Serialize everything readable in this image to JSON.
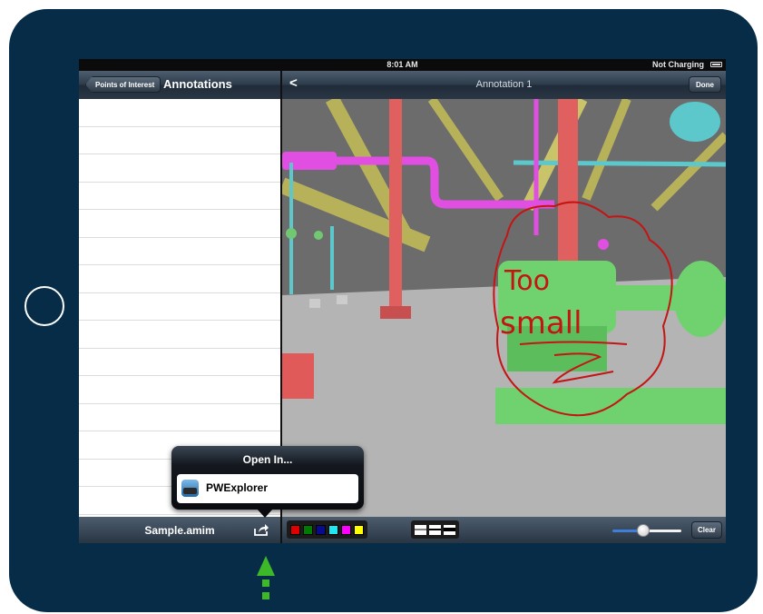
{
  "status_bar": {
    "time": "8:01 AM",
    "battery_label": "Not Charging"
  },
  "left_panel": {
    "back_button": "Points of Interest",
    "title": "Annotations",
    "file_name": "Sample.amim"
  },
  "right_panel": {
    "back_chevron": "<",
    "title": "Annotation 1",
    "done_button": "Done",
    "drawn_text_line1": "Too",
    "drawn_text_line2": "small"
  },
  "toolbar": {
    "colors": [
      "#e00000",
      "#007a00",
      "#0a0a8c",
      "#22e6f0",
      "#ff00ff",
      "#ffff00"
    ],
    "line_widths": [
      "thin",
      "medium",
      "thick"
    ],
    "brush_size": 0.45,
    "clear_button": "Clear"
  },
  "popover": {
    "title": "Open In...",
    "apps": [
      "PWExplorer"
    ]
  },
  "colors": {
    "device_frame": "#062c47",
    "annotation_ink": "#c41414",
    "arrow": "#3cb828"
  }
}
